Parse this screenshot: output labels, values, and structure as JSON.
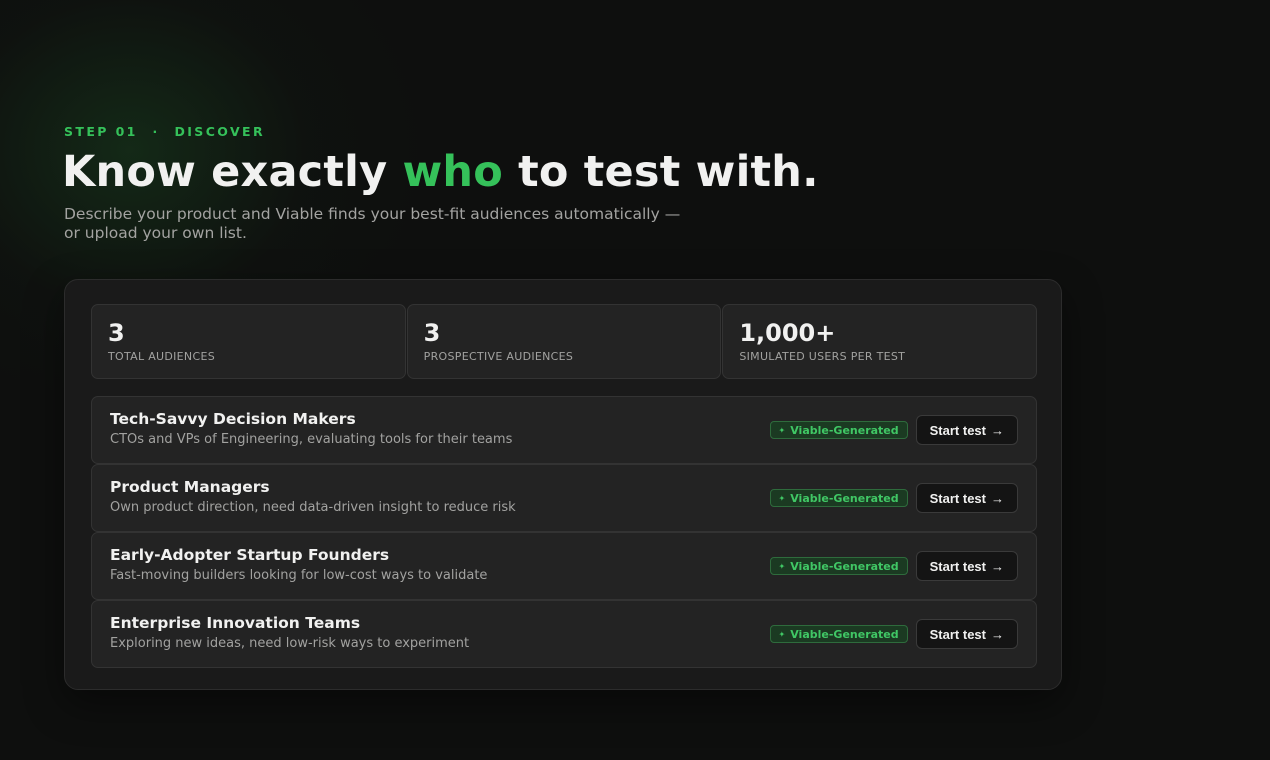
{
  "hero": {
    "eyebrow_step": "STEP 01",
    "eyebrow_dot": "·",
    "eyebrow_section": "DISCOVER",
    "headline_before": "Know exactly ",
    "headline_accent": "who",
    "headline_after": " to test with.",
    "subhead_line1": "Describe your product and Viable finds your best-fit audiences automatically —",
    "subhead_line2": "or upload your own list."
  },
  "stats": [
    {
      "value": "3",
      "label": "TOTAL AUDIENCES"
    },
    {
      "value": "3",
      "label": "PROSPECTIVE AUDIENCES"
    },
    {
      "value": "1,000+",
      "label": "SIMULATED USERS PER TEST"
    }
  ],
  "audiences": [
    {
      "title": "Tech-Savvy Decision Makers",
      "description": "CTOs and VPs of Engineering, evaluating tools for their teams",
      "badge": "Viable-Generated",
      "action": "Start test"
    },
    {
      "title": "Product Managers",
      "description": "Own product direction, need data-driven insight to reduce risk",
      "badge": "Viable-Generated",
      "action": "Start test"
    },
    {
      "title": "Early-Adopter Startup Founders",
      "description": "Fast-moving builders looking for low-cost ways to validate",
      "badge": "Viable-Generated",
      "action": "Start test"
    },
    {
      "title": "Enterprise Innovation Teams",
      "description": "Exploring new ideas, need low-risk ways to experiment",
      "badge": "Viable-Generated",
      "action": "Start test"
    }
  ],
  "icons": {
    "badge_icon": "sparkle-icon",
    "badge_glyph": "✦",
    "action_icon": "arrow-right-icon",
    "action_glyph": "→"
  },
  "colors": {
    "accent": "#35c15a",
    "background": "#0e0f0e",
    "panel": "#1a1a1a",
    "card": "#232323"
  }
}
